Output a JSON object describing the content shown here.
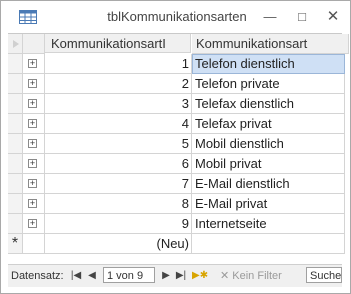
{
  "window": {
    "title": "tblKommunikationsarten"
  },
  "headers": {
    "id": "KommunikationsartI",
    "art": "Kommunikationsart"
  },
  "rows": [
    {
      "id": "1",
      "art": "Telefon dienstlich"
    },
    {
      "id": "2",
      "art": "Telefon private"
    },
    {
      "id": "3",
      "art": "Telefax dienstlich"
    },
    {
      "id": "4",
      "art": "Telefax privat"
    },
    {
      "id": "5",
      "art": "Mobil dienstlich"
    },
    {
      "id": "6",
      "art": "Mobil privat"
    },
    {
      "id": "7",
      "art": "E-Mail dienstlich"
    },
    {
      "id": "8",
      "art": "E-Mail privat"
    },
    {
      "id": "9",
      "art": "Internetseite"
    }
  ],
  "new_row": {
    "marker": "*",
    "label": "(Neu)"
  },
  "navigation": {
    "label": "Datensatz:",
    "current": "1 von 9",
    "filter": "Kein Filter",
    "search": "Suchen"
  },
  "icons": {
    "app": "table-icon",
    "expand": "plus-box-icon",
    "first": "first-record-icon",
    "prev": "previous-record-icon",
    "next": "next-record-icon",
    "last": "last-record-icon",
    "new": "new-record-icon",
    "filter": "filter-icon"
  }
}
